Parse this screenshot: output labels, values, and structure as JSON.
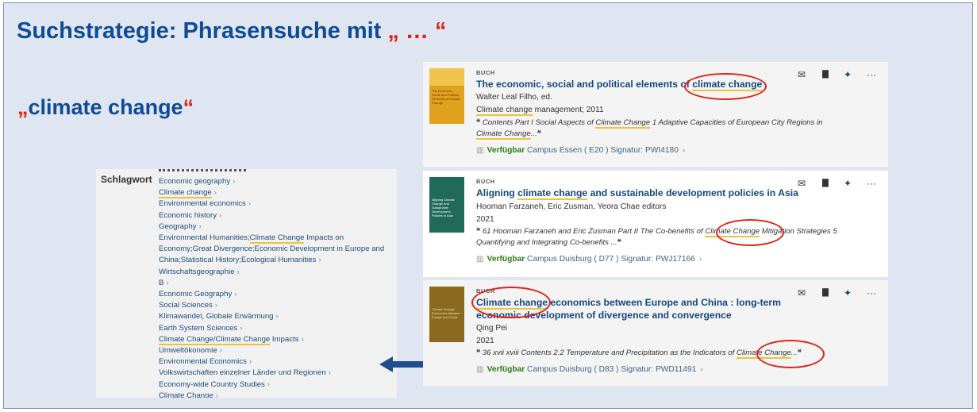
{
  "slide": {
    "title_main": "Suchstrategie: Phrasensuche mit ",
    "title_quotes": "„ … “",
    "phrase_open": "„",
    "phrase_text": "climate change",
    "phrase_close": "“"
  },
  "subject_panel": {
    "label": "Schlagwort",
    "items": [
      {
        "text": "Economic geography"
      },
      {
        "text": "Climate change"
      },
      {
        "text": "Environmental economics"
      },
      {
        "text": "Economic history"
      },
      {
        "text": "Geography"
      },
      {
        "text_a": "Environmental Humanities;",
        "text_b": "Climate Change",
        "text_c": " Impacts on Economy;Great Divergence;Economic Development in Europe and China;Statistical History;Ecological Humanities"
      },
      {
        "text": "Wirtschaftsgeographie"
      },
      {
        "text": "B"
      },
      {
        "text": "Economic Geography"
      },
      {
        "text": "Social Sciences"
      },
      {
        "text": "Klimawandel, Globale Erwärmung"
      },
      {
        "text": "Earth System Sciences"
      },
      {
        "text_a": "Climate Change/Climate Change",
        "text_c": " Impacts"
      },
      {
        "text": "Umweltökonomie"
      },
      {
        "text": "Environmental Economics"
      },
      {
        "text": "Volkswirtschaften einzelner Länder und Regionen"
      },
      {
        "text": "Economy-wide Country Studies"
      },
      {
        "text": "Climate Change"
      }
    ],
    "chevron": "›"
  },
  "results": [
    {
      "type": "BUCH",
      "title_a": "The economic, social and political elements of ",
      "title_hl": "climate change",
      "title_b": "",
      "author": "Walter Leal Filho, ed.",
      "series_hl": "Climate change",
      "series_rest": " management; 2011",
      "snip_a": "Contents Part I Social Aspects of ",
      "snip_hl": "Climate Change",
      "snip_b": " 1 Adaptive Capacities of European City Regions in ",
      "snip_hl2": "Climate Change",
      "snip_c": "...",
      "available": "Verfügbar",
      "location": "Campus Essen ( E20 ) Signatur: PWI4180",
      "cover_color": "#e0a21c",
      "cover_text": "The Economic, Social and Political Elements of Climate Change"
    },
    {
      "type": "BUCH",
      "title_a": "Aligning ",
      "title_hl": "climate change",
      "title_b": " and sustainable development policies in Asia",
      "author": "Hooman Farzaneh, Eric Zusman, Yeora Chae editors",
      "year": "2021",
      "snip_a": "61 Hooman Farzaneh and Eric Zusman Part II The Co-benefits of ",
      "snip_hl": "Climate Change",
      "snip_b": " Mitigation Strategies 5 Quantifying and Integrating Co-benefits ...",
      "available": "Verfügbar",
      "location": "Campus Duisburg ( D77 ) Signatur: PWJ17166",
      "cover_color": "#1f6b58",
      "cover_text": "Aligning Climate Change and Sustainable Development Policies in Asia"
    },
    {
      "type": "BUCH",
      "title_a": "",
      "title_hl": "Climate change",
      "title_b": " economics between Europe and China : long-term economic development of divergence and convergence",
      "author": "Qing Pei",
      "year": "2021",
      "snip_a": "36 xvii xviii Contents 2.2 Temperature and Precipitation as the Indicators of ",
      "snip_hl": "Climate Change",
      "snip_b": "...",
      "available": "Verfügbar",
      "location": "Campus Duisburg ( D83 ) Signatur: PWD11491",
      "cover_color": "#8a6a1e",
      "cover_text": "Climate Change Economics between Europe and China"
    }
  ],
  "icons": {
    "mail": "✉",
    "document": "▇",
    "pin": "✦",
    "more": "···",
    "quote": "❝",
    "book": "▥",
    "arrow": "left-arrow"
  },
  "colors": {
    "title_blue": "#0f4b96",
    "quote_red": "#e01e12",
    "highlight": "#e8c53a",
    "available_green": "#2d7d16"
  }
}
